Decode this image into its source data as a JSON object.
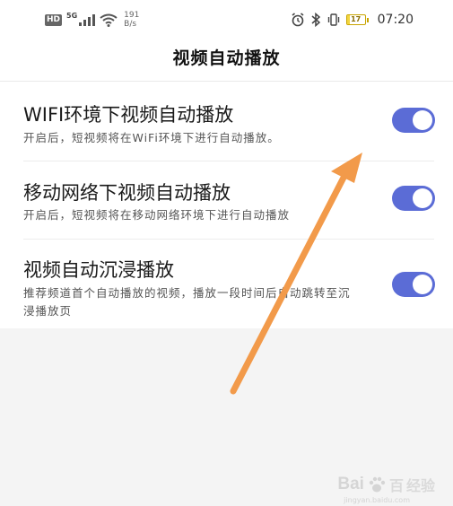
{
  "status_bar": {
    "hd_badge": "HD",
    "network": "5G",
    "speed_value": "191",
    "speed_unit": "B/s",
    "battery": "17",
    "battery_level": 0.17,
    "time": "07:20"
  },
  "header": {
    "title": "视频自动播放"
  },
  "settings": [
    {
      "title": "WIFI环境下视频自动播放",
      "desc": "开启后，短视频将在WiFi环境下进行自动播放。",
      "enabled": true
    },
    {
      "title": "移动网络下视频自动播放",
      "desc": "开启后，短视频将在移动网络环境下进行自动播放",
      "enabled": true
    },
    {
      "title": "视频自动沉浸播放",
      "desc": "推荐频道首个自动播放的视频，播放一段时间后自动跳转至沉浸播放页",
      "enabled": true
    }
  ],
  "colors": {
    "toggle_on": "#5b6cd6",
    "arrow": "#f29a4a"
  },
  "watermark": {
    "brand": "Bai",
    "brand_end": "百",
    "suffix": "经验",
    "url": "jingyan.baidu.com"
  }
}
